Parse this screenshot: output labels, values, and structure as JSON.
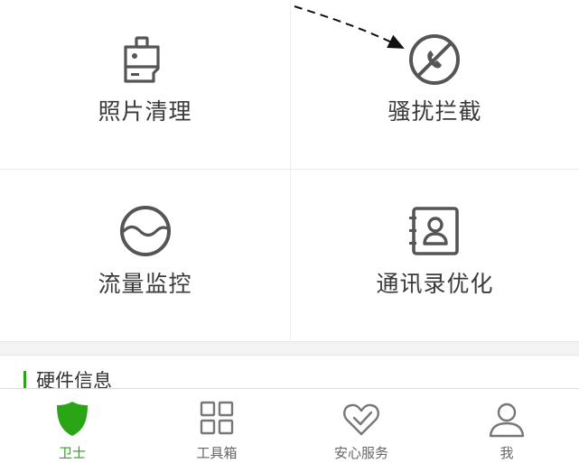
{
  "tools": [
    {
      "label": "照片清理",
      "icon": "brush-icon"
    },
    {
      "label": "骚扰拦截",
      "icon": "blocked-call-icon"
    },
    {
      "label": "流量监控",
      "icon": "water-wave-icon"
    },
    {
      "label": "通讯录优化",
      "icon": "contacts-book-icon"
    }
  ],
  "section": {
    "title": "硬件信息"
  },
  "tabbar": {
    "items": [
      {
        "label": "卫士",
        "icon": "shield-icon",
        "active": true
      },
      {
        "label": "工具箱",
        "icon": "grid-icon",
        "active": false
      },
      {
        "label": "安心服务",
        "icon": "heart-check-icon",
        "active": false
      },
      {
        "label": "我",
        "icon": "user-icon",
        "active": false
      }
    ]
  },
  "colors": {
    "accent": "#2aa515",
    "icon": "#555555",
    "text": "#3a3a3a",
    "muted": "#666666"
  }
}
